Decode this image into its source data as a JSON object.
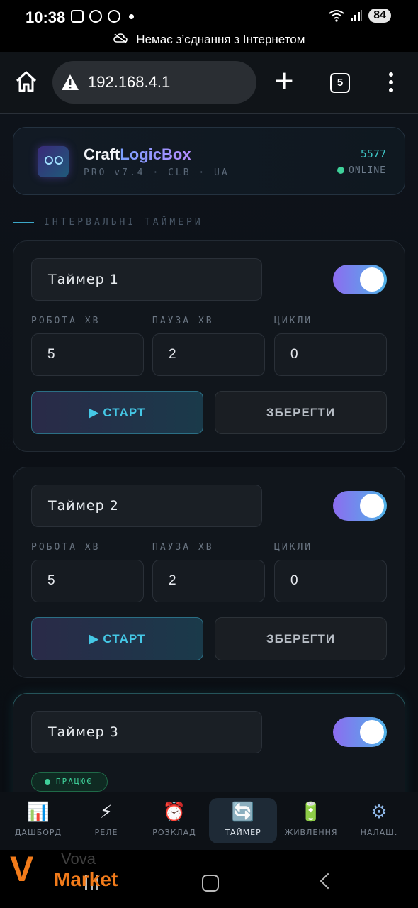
{
  "status_bar": {
    "time": "10:38",
    "battery": "84"
  },
  "offline_notice": "Немає з’єднання з Інтернетом",
  "browser": {
    "url": "192.168.4.1",
    "tab_count": "5"
  },
  "header": {
    "brand_part1": "Craft",
    "brand_part2": "LogicBox",
    "subtitle": "PRO v7.4 · CLB · UA",
    "number": "5577",
    "status": "ONLINE"
  },
  "section_title": "ІНТЕРВАЛЬНІ ТАЙМЕРИ",
  "field_labels": {
    "work": "РОБОТА ХВ",
    "pause": "ПАУЗА ХВ",
    "cycles": "ЦИКЛИ"
  },
  "buttons": {
    "start": "▶ СТАРТ",
    "save": "ЗБЕРЕГТИ"
  },
  "timers": [
    {
      "name": "Таймер 1",
      "enabled": true,
      "work": "5",
      "pause": "2",
      "cycles": "0"
    },
    {
      "name": "Таймер 2",
      "enabled": true,
      "work": "5",
      "pause": "2",
      "cycles": "0"
    },
    {
      "name": "Таймер 3",
      "enabled": true,
      "status_badge": "ПРАЦЮЄ"
    }
  ],
  "nav": [
    {
      "icon": "📊",
      "icon_name": "chart-icon",
      "label": "ДАШБОРД"
    },
    {
      "icon": "⚡",
      "icon_name": "lightning-icon",
      "label": "РЕЛЕ"
    },
    {
      "icon": "⏰",
      "icon_name": "alarm-clock-icon",
      "label": "РОЗКЛАД"
    },
    {
      "icon": "🔄",
      "icon_name": "cycle-arrows-icon",
      "label": "ТАЙМЕР",
      "active": true
    },
    {
      "icon": "🔋",
      "icon_name": "battery-icon",
      "label": "ЖИВЛЕННЯ"
    },
    {
      "icon": "⚙",
      "icon_name": "gear-icon",
      "label": "НАЛАШ."
    }
  ],
  "watermark": {
    "line1": "Vova",
    "line2": "Market"
  },
  "colors": {
    "accent_cyan": "#45c8e6",
    "online_green": "#3fd19a",
    "toggle_start": "#8c6cf0",
    "toggle_end": "#4fb3e8",
    "watermark_orange": "#f27b1a"
  }
}
